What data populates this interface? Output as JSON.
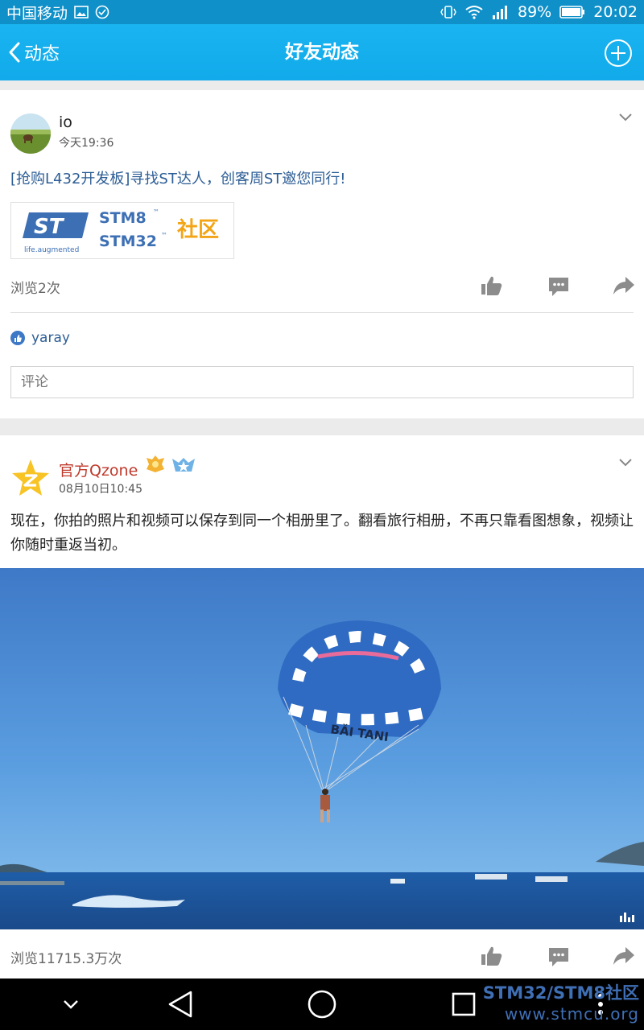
{
  "status_bar": {
    "carrier": "中国移动",
    "battery": "89%",
    "time": "20:02"
  },
  "header": {
    "back_label": "动态",
    "title": "好友动态"
  },
  "post1": {
    "author": "io",
    "time": "今天19:36",
    "link_text": "[抢购L432开发板]寻找ST达人，创客周ST邀您同行!",
    "thumb": {
      "brand": "ST",
      "tagline": "life.augmented",
      "line1": "STM8",
      "line2": "STM32",
      "tm": "™",
      "community": "社区"
    },
    "views": "浏览2次",
    "liked_by": "yaray",
    "comment_placeholder": "评论"
  },
  "post2": {
    "author": "官方Qzone",
    "time": "08月10日10:45",
    "text": "现在，你拍的照片和视频可以保存到同一个相册里了。翻看旅行相册，不再只靠看图想象，视频让你随时重返当初。",
    "parachute_text": "BĂI TANI",
    "views": "浏览11715.3万次"
  },
  "watermark": {
    "line1": "STM32/STM8社区",
    "line2": "www.stmcu.org"
  },
  "colors": {
    "header": "#12aaea",
    "link": "#2c5d95",
    "author2": "#c0392b"
  },
  "icons": [
    "back-icon",
    "plus-icon",
    "chevron-down-icon",
    "thumbs-up-icon",
    "comment-icon",
    "share-icon",
    "like-badge-icon",
    "nav-back-icon",
    "nav-home-icon",
    "nav-recent-icon"
  ]
}
